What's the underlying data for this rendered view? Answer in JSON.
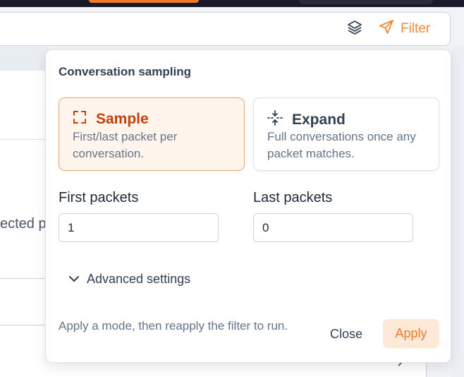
{
  "filter_bar": {
    "filter_label": "Filter"
  },
  "background": {
    "partial_text": "ected p"
  },
  "popover": {
    "title": "Conversation sampling",
    "modes": [
      {
        "name": "Sample",
        "description": "First/last packet per conversation.",
        "selected": true
      },
      {
        "name": "Expand",
        "description": "Full conversations once any packet matches.",
        "selected": false
      }
    ],
    "first_packets": {
      "label": "First packets",
      "value": "1"
    },
    "last_packets": {
      "label": "Last packets",
      "value": "0"
    },
    "advanced_label": "Advanced settings",
    "footer_note": "Apply a mode, then reapply the filter to run.",
    "close_label": "Close",
    "apply_label": "Apply"
  },
  "colors": {
    "accent": "#f07a26",
    "selected_bg": "#fff5ec",
    "selected_border": "#f1a26a",
    "selected_text": "#c2410c"
  },
  "icons": {
    "layers": "layers-icon",
    "filter": "send-icon",
    "sample": "corners-icon",
    "expand": "expand-vertical-icon",
    "advanced": "chevron-down-icon"
  }
}
